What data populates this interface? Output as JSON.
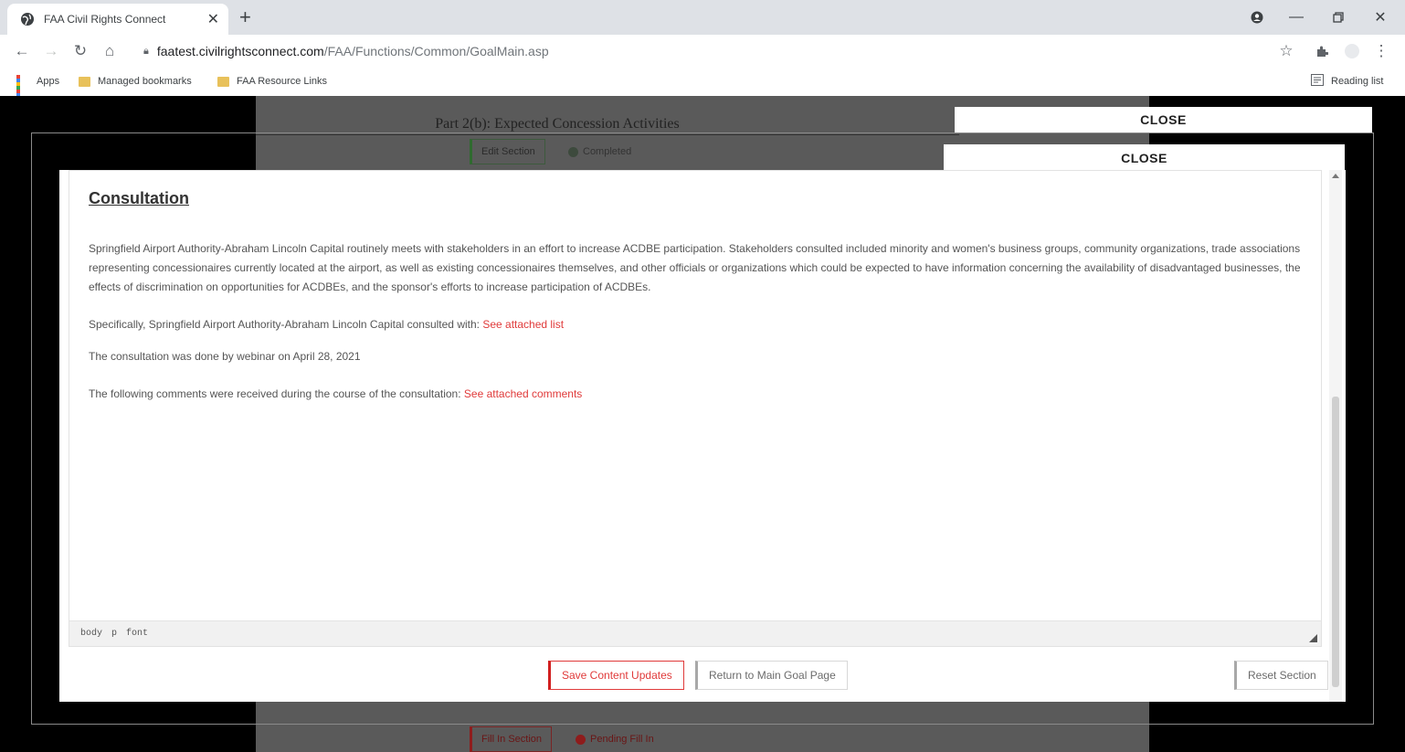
{
  "browser": {
    "tab_title": "FAA Civil Rights Connect",
    "url_host": "faatest.civilrightsconnect.com",
    "url_path": "/FAA/Functions/Common/GoalMain.asp",
    "bookmarks": [
      "Apps",
      "Managed bookmarks",
      "FAA Resource Links"
    ],
    "reading_list": "Reading list"
  },
  "background_page": {
    "heading": "Part 2(b): Expected Concession Activities",
    "edit_section": "Edit Section",
    "completed": "Completed",
    "fill_in_section": "Fill In Section",
    "pending_fill_in": "Pending Fill In"
  },
  "close_labels": [
    "CLOSE",
    "CLOSE"
  ],
  "editor": {
    "heading": "Consultation",
    "paragraph1": "Springfield Airport Authority-Abraham Lincoln Capital routinely meets with stakeholders in an effort to increase ACDBE participation. Stakeholders consulted included minority and women's business groups, community organizations, trade associations representing concessionaires currently located at the airport, as well as existing concessionaires themselves, and other officials or organizations which could be expected to have information concerning the availability of disadvantaged businesses, the effects of discrimination on opportunities for ACDBEs, and the sponsor's efforts to increase participation of ACDBEs.",
    "paragraph2_text": "Specifically, Springfield Airport Authority-Abraham Lincoln Capital consulted with: ",
    "paragraph2_link": "See attached list",
    "paragraph3": "The consultation was done by webinar on April 28, 2021",
    "paragraph4_text": "The following comments were received during the course of the consultation: ",
    "paragraph4_link": "See attached comments",
    "status_path": [
      "body",
      "p",
      "font"
    ]
  },
  "actions": {
    "save": "Save Content Updates",
    "return": "Return to Main Goal Page",
    "reset": "Reset Section"
  },
  "colors": {
    "link_red": "#e03a3a",
    "complete_green": "#2f6b2f",
    "pending_red": "#8f1c1c"
  }
}
